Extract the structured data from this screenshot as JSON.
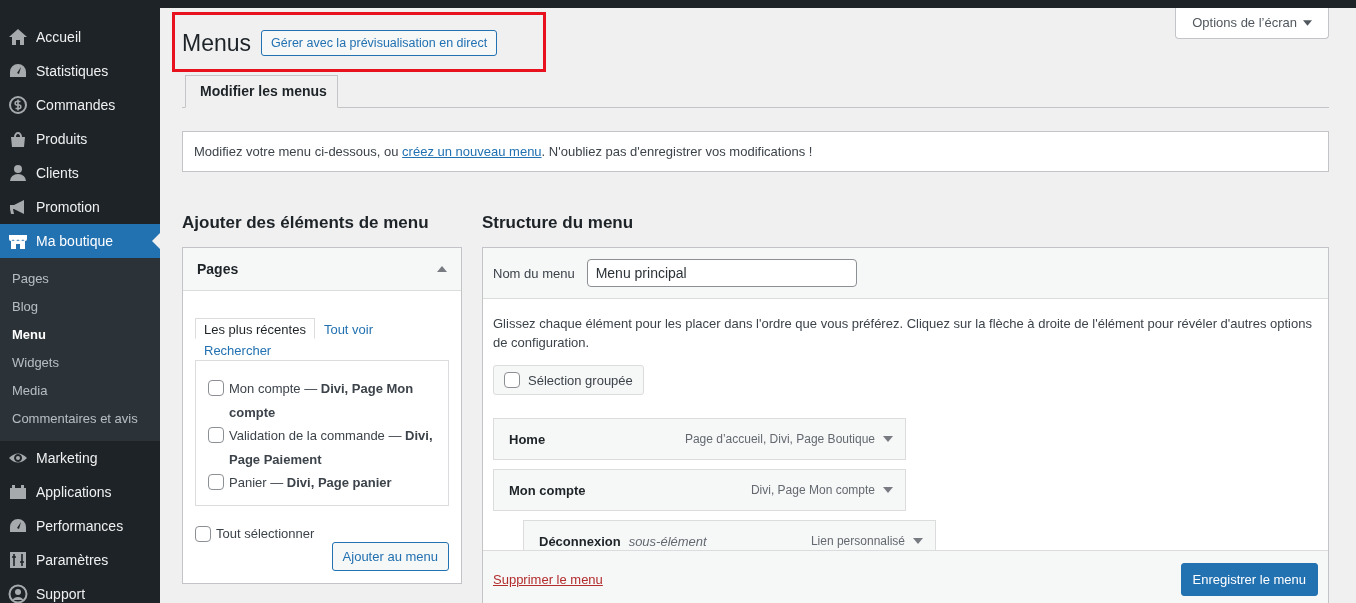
{
  "sidebar": {
    "items": [
      {
        "label": "Accueil",
        "selected": false
      },
      {
        "label": "Statistiques",
        "selected": false
      },
      {
        "label": "Commandes",
        "selected": false
      },
      {
        "label": "Produits",
        "selected": false
      },
      {
        "label": "Clients",
        "selected": false
      },
      {
        "label": "Promotion",
        "selected": false
      },
      {
        "label": "Ma boutique",
        "selected": true,
        "children": [
          {
            "label": "Pages",
            "selected": false
          },
          {
            "label": "Blog",
            "selected": false
          },
          {
            "label": "Menu",
            "selected": true
          },
          {
            "label": "Widgets",
            "selected": false
          },
          {
            "label": "Media",
            "selected": false
          },
          {
            "label": "Commentaires et avis",
            "selected": false
          }
        ]
      },
      {
        "label": "Marketing",
        "selected": false
      },
      {
        "label": "Applications",
        "selected": false
      },
      {
        "label": "Performances",
        "selected": false
      },
      {
        "label": "Paramètres",
        "selected": false
      },
      {
        "label": "Support",
        "selected": false
      }
    ]
  },
  "screen_options": "Options de l’écran",
  "page": {
    "title": "Menus",
    "live_preview_button": "Gérer avec la prévisualisation en direct"
  },
  "tabs": [
    {
      "label": "Modifier les menus",
      "selected": true
    }
  ],
  "notice": {
    "text_before": "Modifiez votre menu ci-dessous, ou ",
    "link": "créez un nouveau menu",
    "text_after": ". N'oubliez pas d'enregistrer vos modifications !"
  },
  "add_items": {
    "title": "Ajouter des éléments de menu",
    "panel": {
      "title": "Pages",
      "expanded": true,
      "tabs": [
        {
          "label": "Les plus récentes",
          "selected": true
        },
        {
          "label": "Tout voir",
          "selected": false
        },
        {
          "label": "Rechercher",
          "selected": false
        }
      ],
      "pages": [
        {
          "label": "Mon compte — **Divi, Page Mon compte**",
          "checked": false
        },
        {
          "label": "Validation de la commande — **Divi, Page Paiement**",
          "checked": false
        },
        {
          "label": "Panier — **Divi, Page panier**",
          "checked": false
        }
      ],
      "select_all": {
        "label": "Tout sélectionner",
        "checked": false
      },
      "add_button": "Ajouter au menu"
    }
  },
  "structure": {
    "title": "Structure du menu",
    "name_label": "Nom du menu",
    "name_value": "Menu principal",
    "instructions": "Glissez chaque élément pour les placer dans l'ordre que vous préférez. Cliquez sur la flèche à droite de l'élément pour révéler d'autres options de configuration.",
    "bulk_select": {
      "label": "Sélection groupée",
      "checked": false
    },
    "items": [
      {
        "title": "Home",
        "type": "Page d’accueil, Divi, Page Boutique"
      },
      {
        "title": "Mon compte",
        "type": "Divi, Page Mon compte",
        "children": [
          {
            "title": "Déconnexion",
            "sub_label": "sous-élément",
            "type": "Lien personnalisé"
          }
        ]
      }
    ],
    "delete_link": "Supprimer le menu",
    "save_button": "Enregistrer le menu"
  }
}
